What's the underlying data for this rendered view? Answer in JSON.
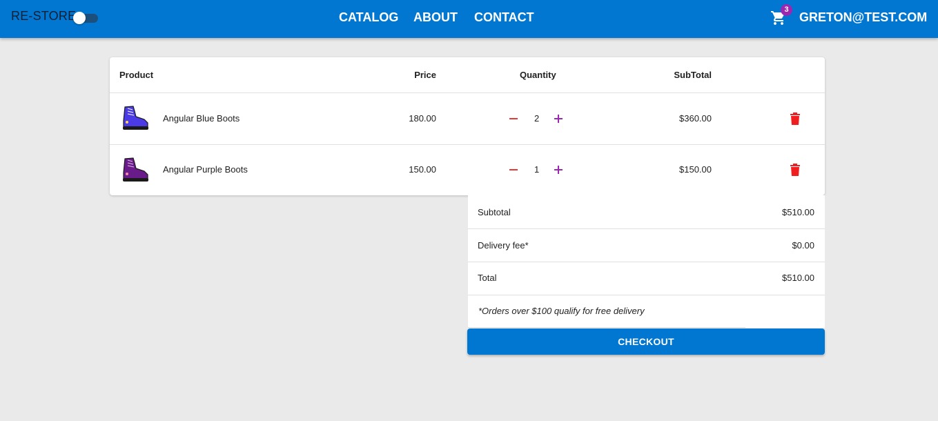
{
  "header": {
    "brand": "RE-STORE",
    "nav": [
      "CATALOG",
      "ABOUT",
      "CONTACT"
    ],
    "cart_count": "3",
    "user_email": "GRETON@TEST.COM"
  },
  "table": {
    "columns": [
      "Product",
      "Price",
      "Quantity",
      "SubTotal"
    ],
    "rows": [
      {
        "name": "Angular Blue Boots",
        "price": "180.00",
        "quantity": "2",
        "subtotal": "$360.00",
        "image_icon": "blue-boot"
      },
      {
        "name": "Angular Purple Boots",
        "price": "150.00",
        "quantity": "1",
        "subtotal": "$150.00",
        "image_icon": "purple-boot"
      }
    ]
  },
  "summary": {
    "subtotal_label": "Subtotal",
    "subtotal_value": "$510.00",
    "delivery_label": "Delivery fee*",
    "delivery_value": "$0.00",
    "total_label": "Total",
    "total_value": "$510.00",
    "note": "*Orders over $100 qualify for free delivery"
  },
  "checkout_label": "CHECKOUT",
  "colors": {
    "primary": "#0277d1",
    "badge": "#9c27b0",
    "remove": "#e53935",
    "add": "#9c27b0",
    "delete": "#f01e1e"
  }
}
